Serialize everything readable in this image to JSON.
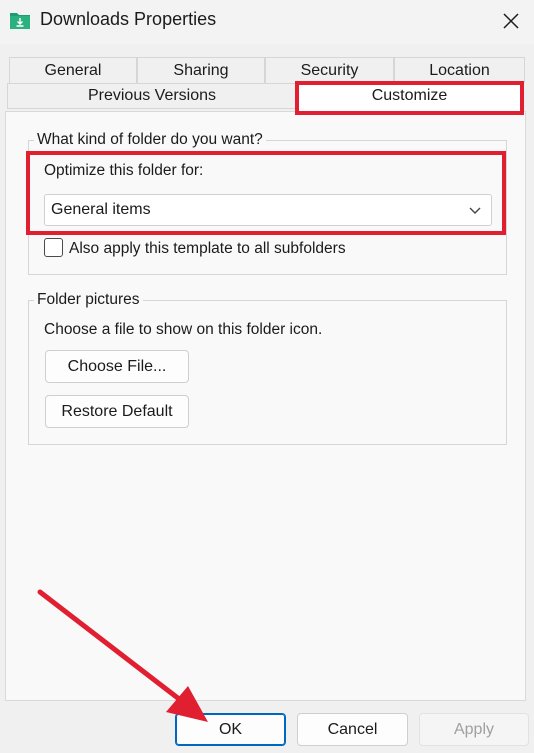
{
  "window": {
    "title": "Downloads Properties"
  },
  "tabs": {
    "row1": [
      "General",
      "Sharing",
      "Security",
      "Location"
    ],
    "row2": [
      "Previous Versions",
      "Customize"
    ],
    "active": "Customize"
  },
  "folder_type": {
    "group_label": "What kind of folder do you want?",
    "optimize_label": "Optimize this folder for:",
    "selected": "General items",
    "apply_subfolders_label": "Also apply this template to all subfolders",
    "apply_subfolders_checked": false
  },
  "folder_pictures": {
    "group_label": "Folder pictures",
    "description": "Choose a file to show on this folder icon.",
    "choose_file_label": "Choose File...",
    "restore_default_label": "Restore Default"
  },
  "footer": {
    "ok_label": "OK",
    "cancel_label": "Cancel",
    "apply_label": "Apply"
  },
  "colors": {
    "highlight": "#e02030",
    "folder_icon": "#1e9e6e",
    "primary_border": "#0067c0"
  },
  "icons": {
    "app": "downloads-folder-icon",
    "close": "close-icon",
    "dropdown": "chevron-down-icon"
  }
}
